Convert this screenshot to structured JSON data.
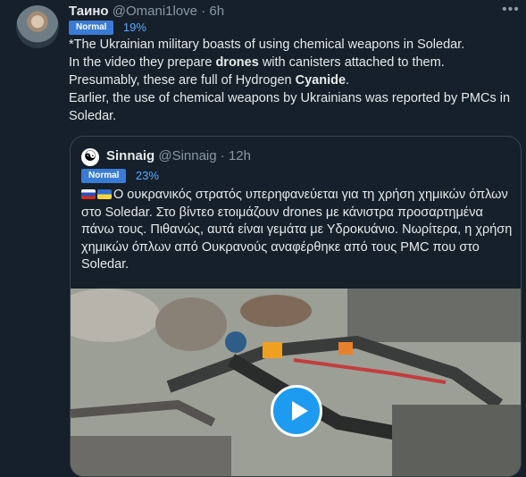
{
  "tweet": {
    "author_name": "Таино",
    "handle": "@Omani1love",
    "separator": "·",
    "time": "6h",
    "badge_label": "Normal",
    "badge_pct": "19%",
    "lines": [
      "*The Ukrainian military boasts of using chemical weapons in Soledar.",
      "In the video they prepare ",
      "drones",
      " with canisters attached to them.",
      "Presumably, these are full of Hydrogen ",
      "Cyanide",
      ".",
      "Earlier, the use of chemical weapons by Ukrainians was reported by PMCs in Soledar."
    ],
    "more_icon": "ellipsis-icon"
  },
  "quote": {
    "author_name": "Sinnaig",
    "handle": "@Sinnaig",
    "separator": "·",
    "time": "12h",
    "badge_label": "Normal",
    "badge_pct": "23%",
    "avatar_symbol": "☯",
    "text": "Ο ουκρανικός στρατός υπερηφανεύεται για τη χρήση χημικών όπλων στο Soledar. Στο βίντεο ετοιμάζουν drones με κάνιστρα προσαρτημένα πάνω τους. Πιθανώς, αυτά είναι γεμάτα με Υδροκυάνιο. Νωρίτερα, η χρήση χημικών όπλων από Ουκρανούς αναφέρθηκε από τους  PMC που στο Soledar.",
    "media_play_icon": "play-icon"
  },
  "colors": {
    "background": "#15202b",
    "text": "#e7e9ea",
    "muted": "#8b98a5",
    "badge": "#3a7bd5",
    "play": "#1d9bf0"
  }
}
